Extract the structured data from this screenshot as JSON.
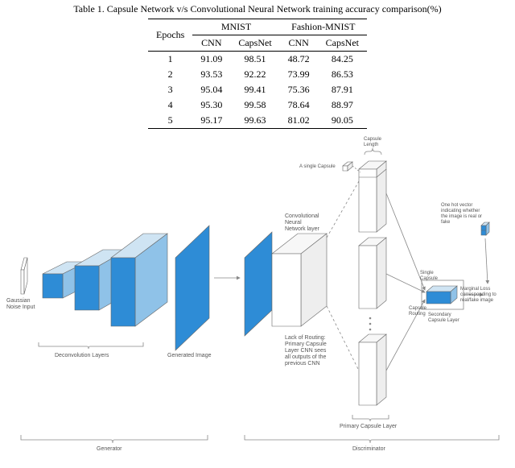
{
  "caption": "Table 1. Capsule Network v/s Convolutional Neural Network training accuracy comparison(%)",
  "header": {
    "epochs": "Epochs",
    "d1": "MNIST",
    "d2": "Fashion-MNIST",
    "c1": "CNN",
    "c2": "CapsNet"
  },
  "chart_data": {
    "type": "table",
    "title": "Capsule Network v/s Convolutional Neural Network training accuracy comparison(%)",
    "columns": [
      "Epochs",
      "MNIST CNN",
      "MNIST CapsNet",
      "Fashion-MNIST CNN",
      "Fashion-MNIST CapsNet"
    ],
    "rows": [
      {
        "epoch": "1",
        "mnist_cnn": "91.09",
        "mnist_caps": "98.51",
        "fm_cnn": "48.72",
        "fm_caps": "84.25"
      },
      {
        "epoch": "2",
        "mnist_cnn": "93.53",
        "mnist_caps": "92.22",
        "fm_cnn": "73.99",
        "fm_caps": "86.53"
      },
      {
        "epoch": "3",
        "mnist_cnn": "95.04",
        "mnist_caps": "99.41",
        "fm_cnn": "75.36",
        "fm_caps": "87.91"
      },
      {
        "epoch": "4",
        "mnist_cnn": "95.30",
        "mnist_caps": "99.58",
        "fm_cnn": "78.64",
        "fm_caps": "88.97"
      },
      {
        "epoch": "5",
        "mnist_cnn": "95.17",
        "mnist_caps": "99.63",
        "fm_cnn": "81.02",
        "fm_caps": "90.05"
      }
    ]
  },
  "labels": {
    "gauss": "Gaussian\nNoise Input",
    "deconv": "Deconvolution Layers",
    "genimg": "Generated Image",
    "generator": "Generator",
    "convnet": "Convolutional\nNeural\nNetwork layer",
    "noroute": "Lack of Routing:\nPrimary Capsule\nLayer CNN sees\nall outputs of the\nprevious CNN",
    "caplen": "Capsule\nLength",
    "singlecap_small": "A single Capsule",
    "primary": "Primary Capsule Layer",
    "discriminator": "Discriminator",
    "singlecap": "Single\nCapsule",
    "caproute": "Capsule\nRouting",
    "secondary": "Secondary\nCapsule Layer",
    "onehot": "One hot vector\nindicating whether\nthe image is real or\nfake",
    "marginal": "Marginal Loss\ncorresponding to\nreal/fake image"
  }
}
